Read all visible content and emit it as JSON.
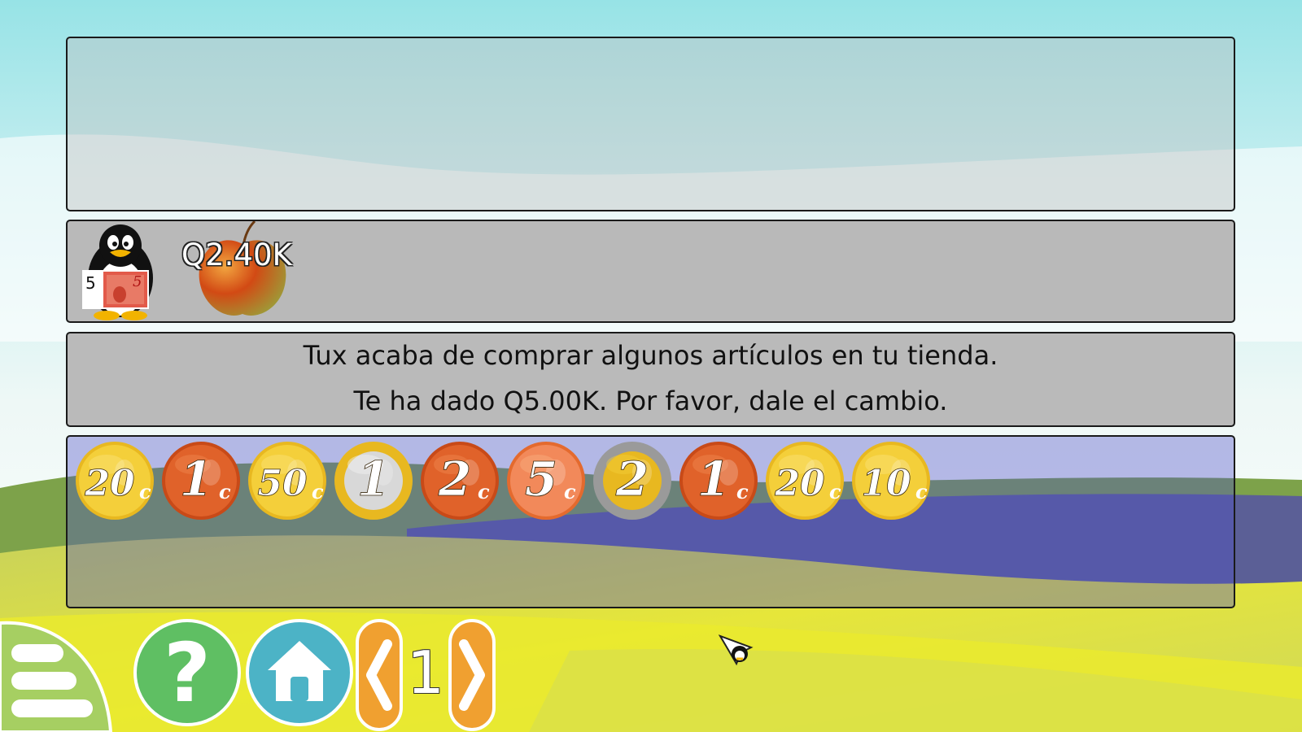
{
  "game": {
    "tux_area": {
      "bill_value": "5",
      "price_label": "Q2.40K"
    },
    "instructions": {
      "line1": "Tux acaba de comprar algunos artículos en tu tienda.",
      "line2": "Te ha dado Q5.00K. Por favor, dale el cambio."
    },
    "wallet": {
      "coins": [
        {
          "value": "20",
          "unit": "c",
          "metal": "gold"
        },
        {
          "value": "1",
          "unit": "c",
          "metal": "copper"
        },
        {
          "value": "50",
          "unit": "c",
          "metal": "gold"
        },
        {
          "value": "1",
          "unit": "",
          "metal": "silver-gold"
        },
        {
          "value": "2",
          "unit": "c",
          "metal": "copper"
        },
        {
          "value": "5",
          "unit": "c",
          "metal": "copper-light"
        },
        {
          "value": "2",
          "unit": "",
          "metal": "gold-silver"
        },
        {
          "value": "1",
          "unit": "c",
          "metal": "copper"
        },
        {
          "value": "20",
          "unit": "c",
          "metal": "gold"
        },
        {
          "value": "10",
          "unit": "c",
          "metal": "gold"
        }
      ]
    }
  },
  "bar": {
    "level": "1",
    "buttons": [
      "menu",
      "help",
      "home",
      "previous-level",
      "next-level"
    ],
    "colors": {
      "help": "#5fbf63",
      "home": "#4cb3c6",
      "nav": "#f0a030"
    }
  }
}
